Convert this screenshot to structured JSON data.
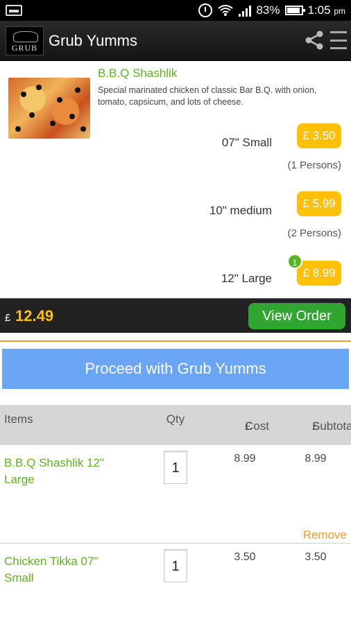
{
  "status_bar": {
    "battery": "83%",
    "time": "1:05",
    "time_suffix": "pm"
  },
  "app_bar": {
    "logo_text": "GRUB",
    "title": "Grub Yumms",
    "share_icon": "share-icon",
    "menu_icon": "overflow-menu-icon"
  },
  "menu_item": {
    "name": "B.B.Q Shashlik",
    "description": "Special marinated chicken of classic Bar B.Q. with onion, tomato, capsicum, and lots of cheese.",
    "sizes": [
      {
        "label": "07\" Small",
        "price": "£ 3.50",
        "persons": "(1 Persons)"
      },
      {
        "label": "10\" medium",
        "price": "£ 5.99",
        "persons": "(2 Persons)"
      },
      {
        "label": "12\" Large",
        "price": "£ 8.99",
        "badge": "1"
      }
    ]
  },
  "total_bar": {
    "currency": "£",
    "amount": "12.49",
    "view_order_label": "View Order"
  },
  "proceed_label": "Proceed with Grub Yumms",
  "order": {
    "headers": {
      "items": "Items",
      "qty": "Qty",
      "cost_line1": "Cost",
      "cost_line2": "£",
      "subtotal_line1": "Subtotal",
      "subtotal_line2": "£"
    },
    "rows": [
      {
        "name": "B.B.Q Shashlik 12\" Large",
        "qty": "1",
        "cost": "8.99",
        "subtotal": "8.99",
        "remove": "Remove"
      },
      {
        "name": "Chicken Tikka 07\" Small",
        "qty": "1",
        "cost": "3.50",
        "subtotal": "3.50"
      }
    ]
  },
  "colors": {
    "accent_green": "#5bb420",
    "price_yellow": "#ffc107",
    "proceed_blue": "#6aa6f5",
    "remove_orange": "#f39a2e"
  }
}
